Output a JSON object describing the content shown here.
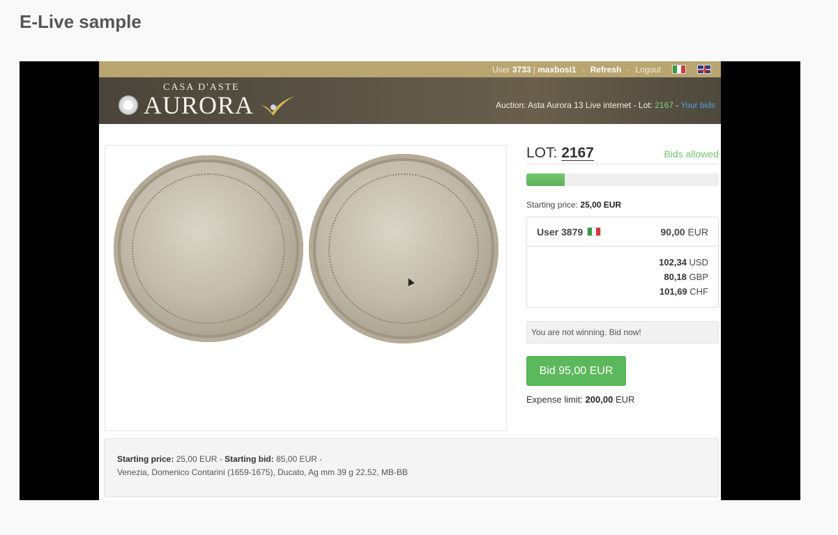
{
  "page": {
    "heading": "E-Live sample"
  },
  "topbar": {
    "user_label": "User",
    "user_id": "3733",
    "divider": "|",
    "username": "maxbosi1",
    "sep1": "-",
    "refresh_label": "Refresh",
    "sep2": "-",
    "logout_label": "Logout"
  },
  "banner": {
    "logo_small": "CASA D'ASTE",
    "logo_main": "AURORA",
    "auction_prefix": "Auction: Asta Aurora 13 Live internet - Lot: ",
    "auction_lot": "2167",
    "auction_sep": " - ",
    "your_bids_label": "Your bids"
  },
  "lot": {
    "label": "LOT:",
    "number": "2167",
    "status": "Bids allowed",
    "progress_fraction": 0.2
  },
  "pricing": {
    "starting_label": "Starting price:",
    "starting_value": "25,00 EUR",
    "top_bidder": "User 3879",
    "top_bid_amount": "90,00",
    "top_bid_currency": "EUR",
    "conversions": [
      {
        "amount": "102,34",
        "currency": "USD"
      },
      {
        "amount": "80,18",
        "currency": "GBP"
      },
      {
        "amount": "101,69",
        "currency": "CHF"
      }
    ]
  },
  "status_message": "You are not winning. Bid now!",
  "bid_button_label": "Bid 95,00 EUR",
  "expense": {
    "label": "Expense limit:",
    "amount": "200,00",
    "currency": "EUR"
  },
  "details": {
    "starting_price_label": "Starting price:",
    "starting_price_value": "25,00 EUR -",
    "starting_bid_label": "Starting bid:",
    "starting_bid_value": "85,00 EUR -",
    "description": "Venezia, Domenico Contarini (1659-1675), Ducato, Ag mm 39 g 22,52, MB-BB"
  },
  "colors": {
    "topbar": "#b8a570",
    "accent_green": "#5cb85c",
    "link_blue": "#4ba3e8"
  }
}
